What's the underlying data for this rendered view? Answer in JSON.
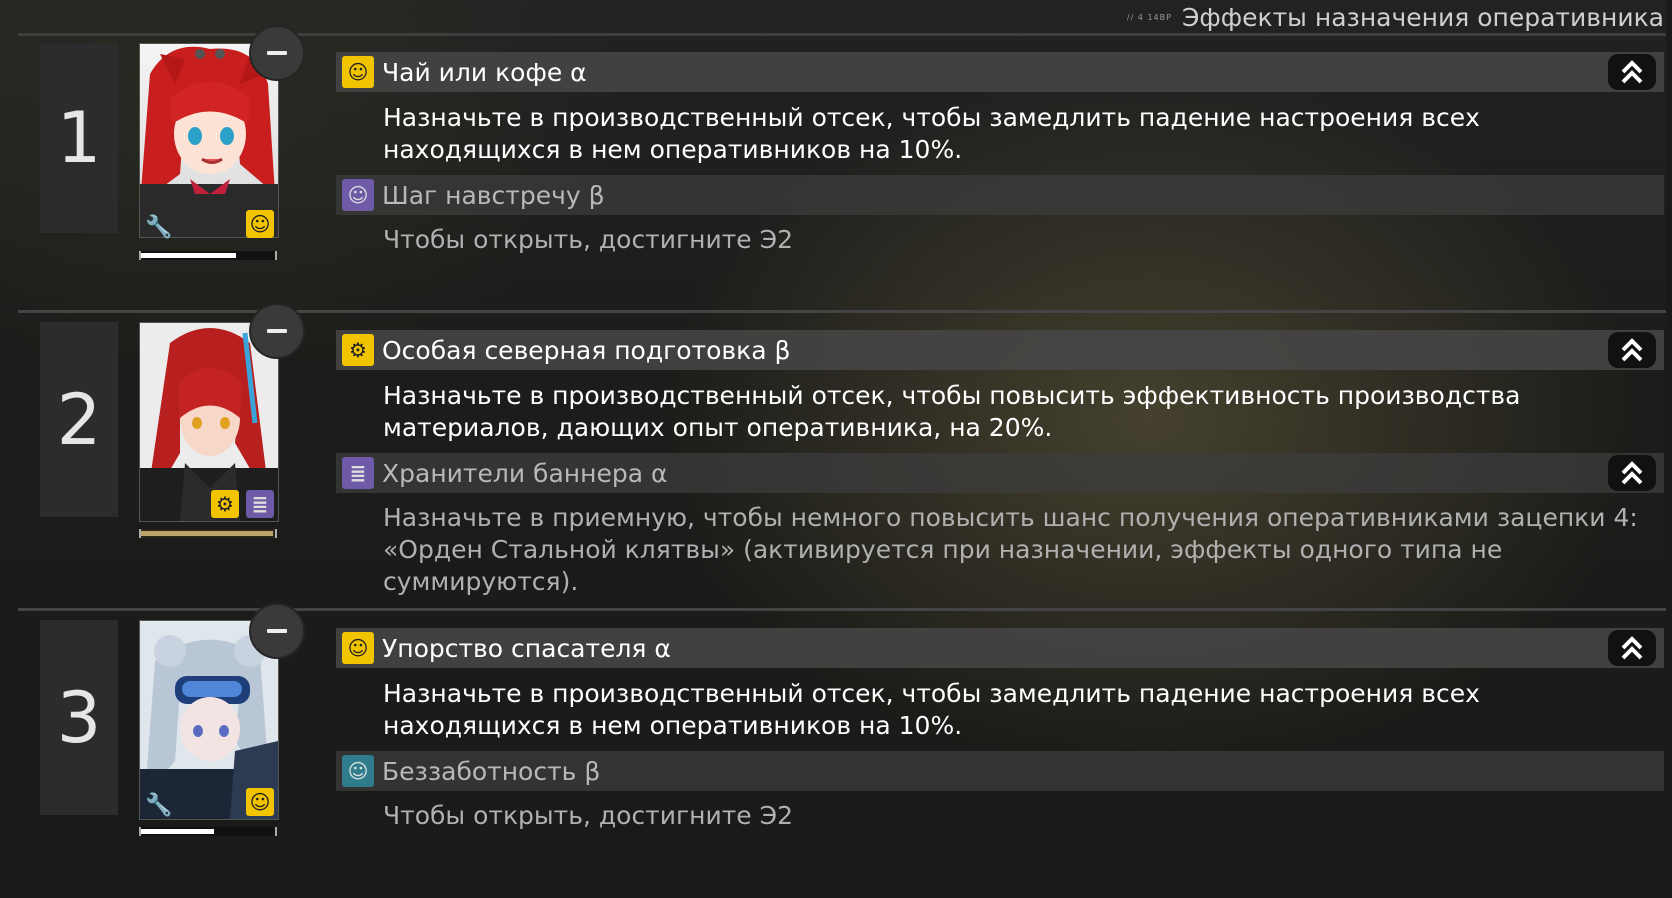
{
  "header": {
    "tag": "// 4 14BP",
    "title": "Эффекты назначения оперативника"
  },
  "operators": [
    {
      "number": "1",
      "progress": 0.72,
      "skills": [
        {
          "name": "Чай или кофе α",
          "icon": "mood-icon",
          "locked": false,
          "description": "Назначьте в производственный отсек, чтобы замедлить падение настроения всех находящихся в нем оперативников на 10%."
        },
        {
          "name": "Шаг навстречу β",
          "icon": "mood-icon",
          "locked": true,
          "description": "Чтобы открыть, достигните Э2"
        }
      ]
    },
    {
      "number": "2",
      "progress": 1.0,
      "skills": [
        {
          "name": "Особая северная подготовка β",
          "icon": "factory-icon",
          "locked": false,
          "description": "Назначьте в производственный отсек, чтобы повысить эффективность производства материалов, дающих опыт оперативника, на 20%."
        },
        {
          "name": "Хранители баннера α",
          "icon": "clue-icon",
          "locked": false,
          "description": "Назначьте в приемную, чтобы немного повысить шанс получения оперативниками зацепки 4: «Орден Стальной клятвы» (активируется при назначении, эффекты одного типа не суммируются)."
        }
      ]
    },
    {
      "number": "3",
      "progress": 0.55,
      "skills": [
        {
          "name": "Упорство спасателя α",
          "icon": "mood-icon",
          "locked": false,
          "description": "Назначьте в производственный отсек, чтобы замедлить падение настроения всех находящихся в нем оперативников на 10%."
        },
        {
          "name": "Беззаботность β",
          "icon": "mood-plus-icon",
          "locked": true,
          "description": "Чтобы открыть, достигните Э2"
        }
      ]
    }
  ],
  "colors": {
    "skill_yellow": "#f2c400",
    "skill_purple": "#6e5aa6",
    "skill_teal": "#2f7d8c"
  }
}
